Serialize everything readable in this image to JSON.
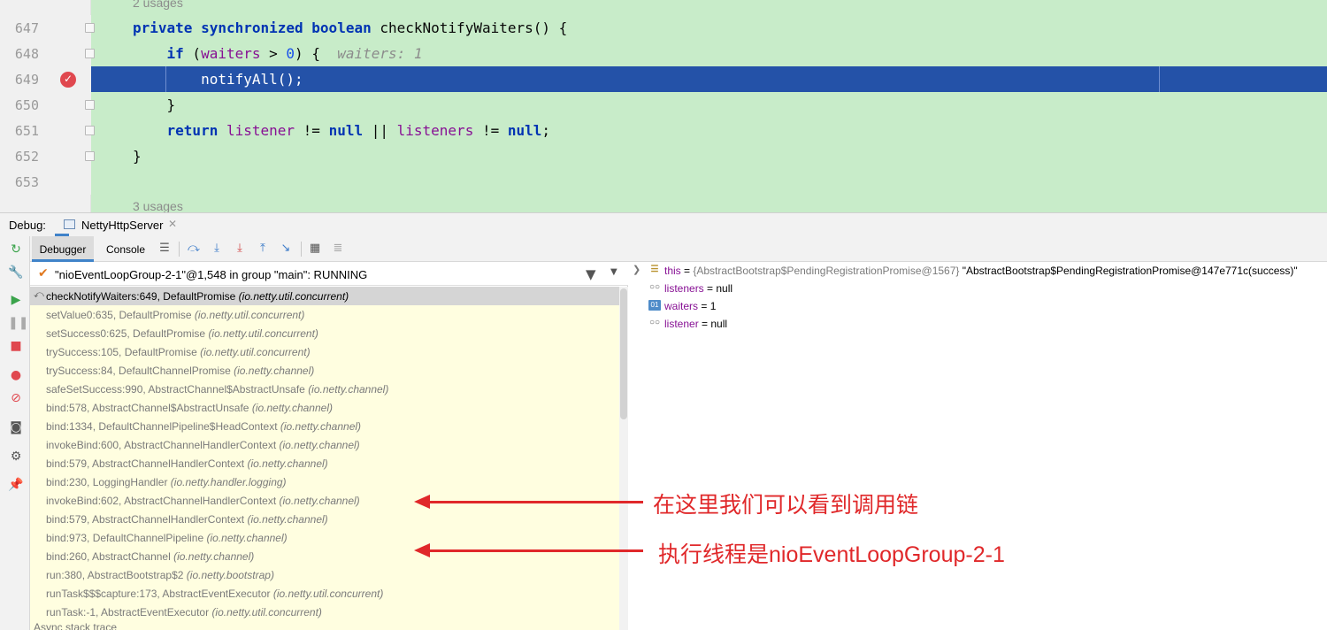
{
  "editor": {
    "usages_top": "2 usages",
    "usages_bottom": "3 usages",
    "lines": [
      {
        "num": "647",
        "segments": [
          {
            "t": "private synchronized boolean ",
            "c": "kw"
          },
          {
            "t": "checkNotifyWaiters() {",
            "c": ""
          }
        ]
      },
      {
        "num": "648",
        "segments": [
          {
            "t": "    ",
            "c": ""
          },
          {
            "t": "if",
            "c": "kw"
          },
          {
            "t": " (",
            "c": ""
          },
          {
            "t": "waiters",
            "c": "fld"
          },
          {
            "t": " > ",
            "c": ""
          },
          {
            "t": "0",
            "c": "num"
          },
          {
            "t": ") {  ",
            "c": ""
          },
          {
            "t": "waiters: 1",
            "c": "inl"
          }
        ]
      },
      {
        "num": "649",
        "segments": [
          {
            "t": "        notifyAll();",
            "c": ""
          }
        ]
      },
      {
        "num": "650",
        "segments": [
          {
            "t": "    }",
            "c": ""
          }
        ]
      },
      {
        "num": "651",
        "segments": [
          {
            "t": "    ",
            "c": ""
          },
          {
            "t": "return",
            "c": "kw"
          },
          {
            "t": " ",
            "c": ""
          },
          {
            "t": "listener",
            "c": "fld"
          },
          {
            "t": " != ",
            "c": ""
          },
          {
            "t": "null",
            "c": "kw"
          },
          {
            "t": " || ",
            "c": ""
          },
          {
            "t": "listeners",
            "c": "fld"
          },
          {
            "t": " != ",
            "c": ""
          },
          {
            "t": "null",
            "c": "kw"
          },
          {
            "t": ";",
            "c": ""
          }
        ]
      },
      {
        "num": "652",
        "segments": [
          {
            "t": "}",
            "c": ""
          }
        ]
      },
      {
        "num": "653",
        "segments": []
      }
    ],
    "current_line": "649"
  },
  "debug": {
    "title": "Debug:",
    "session_tab": "NettyHttpServer",
    "tabs": {
      "debugger": "Debugger",
      "console": "Console"
    },
    "thread": "\"nioEventLoopGroup-2-1\"@1,548 in group \"main\": RUNNING",
    "frames": [
      {
        "method": "checkNotifyWaiters:649, DefaultPromise",
        "pkg": "(io.netty.util.concurrent)"
      },
      {
        "method": "setValue0:635, DefaultPromise",
        "pkg": "(io.netty.util.concurrent)"
      },
      {
        "method": "setSuccess0:625, DefaultPromise",
        "pkg": "(io.netty.util.concurrent)"
      },
      {
        "method": "trySuccess:105, DefaultPromise",
        "pkg": "(io.netty.util.concurrent)"
      },
      {
        "method": "trySuccess:84, DefaultChannelPromise",
        "pkg": "(io.netty.channel)"
      },
      {
        "method": "safeSetSuccess:990, AbstractChannel$AbstractUnsafe",
        "pkg": "(io.netty.channel)"
      },
      {
        "method": "bind:578, AbstractChannel$AbstractUnsafe",
        "pkg": "(io.netty.channel)"
      },
      {
        "method": "bind:1334, DefaultChannelPipeline$HeadContext",
        "pkg": "(io.netty.channel)"
      },
      {
        "method": "invokeBind:600, AbstractChannelHandlerContext",
        "pkg": "(io.netty.channel)"
      },
      {
        "method": "bind:579, AbstractChannelHandlerContext",
        "pkg": "(io.netty.channel)"
      },
      {
        "method": "bind:230, LoggingHandler",
        "pkg": "(io.netty.handler.logging)"
      },
      {
        "method": "invokeBind:602, AbstractChannelHandlerContext",
        "pkg": "(io.netty.channel)"
      },
      {
        "method": "bind:579, AbstractChannelHandlerContext",
        "pkg": "(io.netty.channel)"
      },
      {
        "method": "bind:973, DefaultChannelPipeline",
        "pkg": "(io.netty.channel)"
      },
      {
        "method": "bind:260, AbstractChannel",
        "pkg": "(io.netty.channel)"
      },
      {
        "method": "run:380, AbstractBootstrap$2",
        "pkg": "(io.netty.bootstrap)"
      },
      {
        "method": "runTask$$$capture:173, AbstractEventExecutor",
        "pkg": "(io.netty.util.concurrent)"
      },
      {
        "method": "runTask:-1, AbstractEventExecutor",
        "pkg": "(io.netty.util.concurrent)"
      }
    ],
    "frames_more": "Async stack trace",
    "variables": [
      {
        "name": "this",
        "eq": " = ",
        "type": "{AbstractBootstrap$PendingRegistrationPromise@1567} ",
        "value": "\"AbstractBootstrap$PendingRegistrationPromise@147e771c(success)\"",
        "icon": "field-icon"
      },
      {
        "name": "listeners",
        "eq": " = ",
        "type": "",
        "value": "null",
        "icon": "watch-icon"
      },
      {
        "name": "waiters",
        "eq": " = ",
        "type": "",
        "value": "1",
        "icon": "int-icon"
      },
      {
        "name": "listener",
        "eq": " = ",
        "type": "",
        "value": "null",
        "icon": "watch-icon"
      }
    ]
  },
  "annotations": {
    "call_chain": "在这里我们可以看到调用链",
    "thread_note": "执行线程是nioEventLoopGroup-2-1",
    "color": "#e0282a"
  }
}
